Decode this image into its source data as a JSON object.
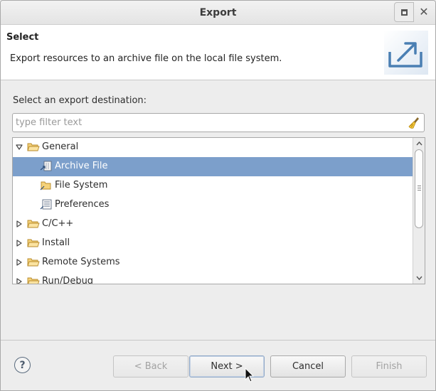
{
  "window": {
    "title": "Export"
  },
  "header": {
    "title": "Select",
    "description": "Export resources to an archive file on the local file system."
  },
  "body": {
    "prompt": "Select an export destination:",
    "filter": {
      "value": "",
      "placeholder": "type filter text"
    }
  },
  "tree": {
    "items": [
      {
        "label": "General",
        "level": 0,
        "expanded": true,
        "icon": "folder-open-icon"
      },
      {
        "label": "Archive File",
        "level": 1,
        "selected": true,
        "icon": "archive-file-icon"
      },
      {
        "label": "File System",
        "level": 1,
        "icon": "file-system-icon"
      },
      {
        "label": "Preferences",
        "level": 1,
        "icon": "preferences-icon"
      },
      {
        "label": "C/C++",
        "level": 0,
        "expanded": false,
        "icon": "folder-icon"
      },
      {
        "label": "Install",
        "level": 0,
        "expanded": false,
        "icon": "folder-icon"
      },
      {
        "label": "Remote Systems",
        "level": 0,
        "expanded": false,
        "icon": "folder-icon"
      },
      {
        "label": "Run/Debug",
        "level": 0,
        "expanded": false,
        "icon": "folder-icon"
      }
    ]
  },
  "buttons": {
    "help": "?",
    "back": "< Back",
    "next": "Next >",
    "cancel": "Cancel",
    "finish": "Finish"
  },
  "colors": {
    "selection": "#7c9fcb",
    "folder": "#e8b64a"
  }
}
